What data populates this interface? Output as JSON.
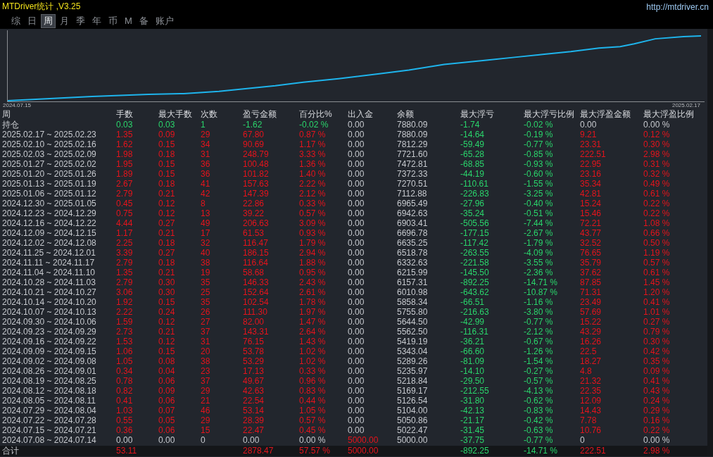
{
  "title_bar": {
    "title": "MTDriver统计 ,V3.25",
    "url": "http://mtdriver.cn"
  },
  "menu": [
    {
      "label": "综",
      "selected": false
    },
    {
      "label": "日",
      "selected": false
    },
    {
      "label": "周",
      "selected": true
    },
    {
      "label": "月",
      "selected": false
    },
    {
      "label": "季",
      "selected": false
    },
    {
      "label": "年",
      "selected": false
    },
    {
      "label": "币",
      "selected": false
    },
    {
      "label": "M",
      "selected": false
    },
    {
      "label": "备",
      "selected": false
    },
    {
      "label": "账户",
      "selected": false
    }
  ],
  "equity_chart": {
    "start_label": "2024.07.15",
    "end_label": "2025.02.17"
  },
  "table": {
    "columns": [
      "周",
      "手数",
      "最大手数",
      "次数",
      "盈亏金额",
      "百分比%",
      "出入金",
      "余额",
      "最大浮亏",
      "最大浮亏比例",
      "最大浮盈金额",
      "最大浮盈比例"
    ],
    "rows": [
      {
        "cells": [
          {
            "text": "持仓"
          },
          {
            "text": "0.03",
            "color": "#2ad46b"
          },
          {
            "text": "0.03",
            "color": "#2ad46b"
          },
          {
            "text": "1",
            "color": "#2ad46b"
          },
          {
            "text": "-1.62",
            "color": "#2ad46b"
          },
          {
            "text": "-0.02 %",
            "color": "#2ad46b"
          },
          {
            "text": "0.00",
            "color": "#c6c9ce"
          },
          {
            "text": "7880.09"
          },
          {
            "text": "-1.74",
            "color": "#2ad46b"
          },
          {
            "text": "-0.02 %",
            "color": "#2ad46b"
          },
          {
            "text": "0.00",
            "color": "#c6c9ce"
          },
          {
            "text": "0.00 %",
            "color": "#c6c9ce"
          }
        ]
      },
      {
        "cells": [
          {
            "text": "2025.02.17 ~ 2025.02.23"
          },
          {
            "text": "1.35",
            "color": "#e5141c"
          },
          {
            "text": "0.09",
            "color": "#e5141c"
          },
          {
            "text": "29",
            "color": "#e5141c"
          },
          {
            "text": "67.80",
            "color": "#e5141c"
          },
          {
            "text": "0.87 %",
            "color": "#e5141c"
          },
          {
            "text": "0.00",
            "color": "#c6c9ce"
          },
          {
            "text": "7880.09"
          },
          {
            "text": "-14.64",
            "color": "#2ad46b"
          },
          {
            "text": "-0.19 %",
            "color": "#2ad46b"
          },
          {
            "text": "9.21",
            "color": "#e5141c"
          },
          {
            "text": "0.12 %",
            "color": "#e5141c"
          }
        ]
      },
      {
        "cells": [
          {
            "text": "2025.02.10 ~ 2025.02.16"
          },
          {
            "text": "1.62",
            "color": "#e5141c"
          },
          {
            "text": "0.15",
            "color": "#e5141c"
          },
          {
            "text": "34",
            "color": "#e5141c"
          },
          {
            "text": "90.69",
            "color": "#e5141c"
          },
          {
            "text": "1.17 %",
            "color": "#e5141c"
          },
          {
            "text": "0.00",
            "color": "#c6c9ce"
          },
          {
            "text": "7812.29"
          },
          {
            "text": "-59.49",
            "color": "#2ad46b"
          },
          {
            "text": "-0.77 %",
            "color": "#2ad46b"
          },
          {
            "text": "23.31",
            "color": "#e5141c"
          },
          {
            "text": "0.30 %",
            "color": "#e5141c"
          }
        ]
      },
      {
        "cells": [
          {
            "text": "2025.02.03 ~ 2025.02.09"
          },
          {
            "text": "1.98",
            "color": "#e5141c"
          },
          {
            "text": "0.18",
            "color": "#e5141c"
          },
          {
            "text": "31",
            "color": "#e5141c"
          },
          {
            "text": "248.79",
            "color": "#e5141c"
          },
          {
            "text": "3.33 %",
            "color": "#e5141c"
          },
          {
            "text": "0.00",
            "color": "#c6c9ce"
          },
          {
            "text": "7721.60"
          },
          {
            "text": "-65.28",
            "color": "#2ad46b"
          },
          {
            "text": "-0.85 %",
            "color": "#2ad46b"
          },
          {
            "text": "222.51",
            "color": "#e5141c"
          },
          {
            "text": "2.98 %",
            "color": "#e5141c"
          }
        ]
      },
      {
        "cells": [
          {
            "text": "2025.01.27 ~ 2025.02.02"
          },
          {
            "text": "1.95",
            "color": "#e5141c"
          },
          {
            "text": "0.15",
            "color": "#e5141c"
          },
          {
            "text": "36",
            "color": "#e5141c"
          },
          {
            "text": "100.48",
            "color": "#e5141c"
          },
          {
            "text": "1.36 %",
            "color": "#e5141c"
          },
          {
            "text": "0.00",
            "color": "#c6c9ce"
          },
          {
            "text": "7472.81"
          },
          {
            "text": "-68.85",
            "color": "#2ad46b"
          },
          {
            "text": "-0.93 %",
            "color": "#2ad46b"
          },
          {
            "text": "22.95",
            "color": "#e5141c"
          },
          {
            "text": "0.31 %",
            "color": "#e5141c"
          }
        ]
      },
      {
        "cells": [
          {
            "text": "2025.01.20 ~ 2025.01.26"
          },
          {
            "text": "1.89",
            "color": "#e5141c"
          },
          {
            "text": "0.15",
            "color": "#e5141c"
          },
          {
            "text": "36",
            "color": "#e5141c"
          },
          {
            "text": "101.82",
            "color": "#e5141c"
          },
          {
            "text": "1.40 %",
            "color": "#e5141c"
          },
          {
            "text": "0.00",
            "color": "#c6c9ce"
          },
          {
            "text": "7372.33"
          },
          {
            "text": "-44.19",
            "color": "#2ad46b"
          },
          {
            "text": "-0.60 %",
            "color": "#2ad46b"
          },
          {
            "text": "23.16",
            "color": "#e5141c"
          },
          {
            "text": "0.32 %",
            "color": "#e5141c"
          }
        ]
      },
      {
        "cells": [
          {
            "text": "2025.01.13 ~ 2025.01.19"
          },
          {
            "text": "2.67",
            "color": "#e5141c"
          },
          {
            "text": "0.18",
            "color": "#e5141c"
          },
          {
            "text": "41",
            "color": "#e5141c"
          },
          {
            "text": "157.63",
            "color": "#e5141c"
          },
          {
            "text": "2.22 %",
            "color": "#e5141c"
          },
          {
            "text": "0.00",
            "color": "#c6c9ce"
          },
          {
            "text": "7270.51"
          },
          {
            "text": "-110.61",
            "color": "#2ad46b"
          },
          {
            "text": "-1.55 %",
            "color": "#2ad46b"
          },
          {
            "text": "35.34",
            "color": "#e5141c"
          },
          {
            "text": "0.49 %",
            "color": "#e5141c"
          }
        ]
      },
      {
        "cells": [
          {
            "text": "2025.01.06 ~ 2025.01.12"
          },
          {
            "text": "2.79",
            "color": "#e5141c"
          },
          {
            "text": "0.21",
            "color": "#e5141c"
          },
          {
            "text": "42",
            "color": "#e5141c"
          },
          {
            "text": "147.39",
            "color": "#e5141c"
          },
          {
            "text": "2.12 %",
            "color": "#e5141c"
          },
          {
            "text": "0.00",
            "color": "#c6c9ce"
          },
          {
            "text": "7112.88"
          },
          {
            "text": "-226.83",
            "color": "#2ad46b"
          },
          {
            "text": "-3.25 %",
            "color": "#2ad46b"
          },
          {
            "text": "42.81",
            "color": "#e5141c"
          },
          {
            "text": "0.61 %",
            "color": "#e5141c"
          }
        ]
      },
      {
        "cells": [
          {
            "text": "2024.12.30 ~ 2025.01.05"
          },
          {
            "text": "0.45",
            "color": "#e5141c"
          },
          {
            "text": "0.12",
            "color": "#e5141c"
          },
          {
            "text": "8",
            "color": "#e5141c"
          },
          {
            "text": "22.86",
            "color": "#e5141c"
          },
          {
            "text": "0.33 %",
            "color": "#e5141c"
          },
          {
            "text": "0.00",
            "color": "#c6c9ce"
          },
          {
            "text": "6965.49"
          },
          {
            "text": "-27.96",
            "color": "#2ad46b"
          },
          {
            "text": "-0.40 %",
            "color": "#2ad46b"
          },
          {
            "text": "15.24",
            "color": "#e5141c"
          },
          {
            "text": "0.22 %",
            "color": "#e5141c"
          }
        ]
      },
      {
        "cells": [
          {
            "text": "2024.12.23 ~ 2024.12.29"
          },
          {
            "text": "0.75",
            "color": "#e5141c"
          },
          {
            "text": "0.12",
            "color": "#e5141c"
          },
          {
            "text": "13",
            "color": "#e5141c"
          },
          {
            "text": "39.22",
            "color": "#e5141c"
          },
          {
            "text": "0.57 %",
            "color": "#e5141c"
          },
          {
            "text": "0.00",
            "color": "#c6c9ce"
          },
          {
            "text": "6942.63"
          },
          {
            "text": "-35.24",
            "color": "#2ad46b"
          },
          {
            "text": "-0.51 %",
            "color": "#2ad46b"
          },
          {
            "text": "15.46",
            "color": "#e5141c"
          },
          {
            "text": "0.22 %",
            "color": "#e5141c"
          }
        ]
      },
      {
        "cells": [
          {
            "text": "2024.12.16 ~ 2024.12.22"
          },
          {
            "text": "4.44",
            "color": "#e5141c"
          },
          {
            "text": "0.27",
            "color": "#e5141c"
          },
          {
            "text": "49",
            "color": "#e5141c"
          },
          {
            "text": "206.63",
            "color": "#e5141c"
          },
          {
            "text": "3.09 %",
            "color": "#e5141c"
          },
          {
            "text": "0.00",
            "color": "#c6c9ce"
          },
          {
            "text": "6903.41"
          },
          {
            "text": "-505.56",
            "color": "#2ad46b"
          },
          {
            "text": "-7.44 %",
            "color": "#2ad46b"
          },
          {
            "text": "72.21",
            "color": "#e5141c"
          },
          {
            "text": "1.08 %",
            "color": "#e5141c"
          }
        ]
      },
      {
        "cells": [
          {
            "text": "2024.12.09 ~ 2024.12.15"
          },
          {
            "text": "1.17",
            "color": "#e5141c"
          },
          {
            "text": "0.21",
            "color": "#e5141c"
          },
          {
            "text": "17",
            "color": "#e5141c"
          },
          {
            "text": "61.53",
            "color": "#e5141c"
          },
          {
            "text": "0.93 %",
            "color": "#e5141c"
          },
          {
            "text": "0.00",
            "color": "#c6c9ce"
          },
          {
            "text": "6696.78"
          },
          {
            "text": "-177.15",
            "color": "#2ad46b"
          },
          {
            "text": "-2.67 %",
            "color": "#2ad46b"
          },
          {
            "text": "43.77",
            "color": "#e5141c"
          },
          {
            "text": "0.66 %",
            "color": "#e5141c"
          }
        ]
      },
      {
        "cells": [
          {
            "text": "2024.12.02 ~ 2024.12.08"
          },
          {
            "text": "2.25",
            "color": "#e5141c"
          },
          {
            "text": "0.18",
            "color": "#e5141c"
          },
          {
            "text": "32",
            "color": "#e5141c"
          },
          {
            "text": "116.47",
            "color": "#e5141c"
          },
          {
            "text": "1.79 %",
            "color": "#e5141c"
          },
          {
            "text": "0.00",
            "color": "#c6c9ce"
          },
          {
            "text": "6635.25"
          },
          {
            "text": "-117.42",
            "color": "#2ad46b"
          },
          {
            "text": "-1.79 %",
            "color": "#2ad46b"
          },
          {
            "text": "32.52",
            "color": "#e5141c"
          },
          {
            "text": "0.50 %",
            "color": "#e5141c"
          }
        ]
      },
      {
        "cells": [
          {
            "text": "2024.11.25 ~ 2024.12.01"
          },
          {
            "text": "3.39",
            "color": "#e5141c"
          },
          {
            "text": "0.27",
            "color": "#e5141c"
          },
          {
            "text": "40",
            "color": "#e5141c"
          },
          {
            "text": "186.15",
            "color": "#e5141c"
          },
          {
            "text": "2.94 %",
            "color": "#e5141c"
          },
          {
            "text": "0.00",
            "color": "#c6c9ce"
          },
          {
            "text": "6518.78"
          },
          {
            "text": "-263.55",
            "color": "#2ad46b"
          },
          {
            "text": "-4.09 %",
            "color": "#2ad46b"
          },
          {
            "text": "76.65",
            "color": "#e5141c"
          },
          {
            "text": "1.19 %",
            "color": "#e5141c"
          }
        ]
      },
      {
        "cells": [
          {
            "text": "2024.11.11 ~ 2024.11.17"
          },
          {
            "text": "2.79",
            "color": "#e5141c"
          },
          {
            "text": "0.18",
            "color": "#e5141c"
          },
          {
            "text": "38",
            "color": "#e5141c"
          },
          {
            "text": "116.64",
            "color": "#e5141c"
          },
          {
            "text": "1.88 %",
            "color": "#e5141c"
          },
          {
            "text": "0.00",
            "color": "#c6c9ce"
          },
          {
            "text": "6332.63"
          },
          {
            "text": "-221.58",
            "color": "#2ad46b"
          },
          {
            "text": "-3.55 %",
            "color": "#2ad46b"
          },
          {
            "text": "35.79",
            "color": "#e5141c"
          },
          {
            "text": "0.57 %",
            "color": "#e5141c"
          }
        ]
      },
      {
        "cells": [
          {
            "text": "2024.11.04 ~ 2024.11.10"
          },
          {
            "text": "1.35",
            "color": "#e5141c"
          },
          {
            "text": "0.21",
            "color": "#e5141c"
          },
          {
            "text": "19",
            "color": "#e5141c"
          },
          {
            "text": "58.68",
            "color": "#e5141c"
          },
          {
            "text": "0.95 %",
            "color": "#e5141c"
          },
          {
            "text": "0.00",
            "color": "#c6c9ce"
          },
          {
            "text": "6215.99"
          },
          {
            "text": "-145.50",
            "color": "#2ad46b"
          },
          {
            "text": "-2.36 %",
            "color": "#2ad46b"
          },
          {
            "text": "37.62",
            "color": "#e5141c"
          },
          {
            "text": "0.61 %",
            "color": "#e5141c"
          }
        ]
      },
      {
        "cells": [
          {
            "text": "2024.10.28 ~ 2024.11.03"
          },
          {
            "text": "2.79",
            "color": "#e5141c"
          },
          {
            "text": "0.30",
            "color": "#e5141c"
          },
          {
            "text": "35",
            "color": "#e5141c"
          },
          {
            "text": "146.33",
            "color": "#e5141c"
          },
          {
            "text": "2.43 %",
            "color": "#e5141c"
          },
          {
            "text": "0.00",
            "color": "#c6c9ce"
          },
          {
            "text": "6157.31"
          },
          {
            "text": "-892.25",
            "color": "#2ad46b"
          },
          {
            "text": "-14.71 %",
            "color": "#2ad46b"
          },
          {
            "text": "87.85",
            "color": "#e5141c"
          },
          {
            "text": "1.45 %",
            "color": "#e5141c"
          }
        ]
      },
      {
        "cells": [
          {
            "text": "2024.10.21 ~ 2024.10.27"
          },
          {
            "text": "3.06",
            "color": "#e5141c"
          },
          {
            "text": "0.30",
            "color": "#e5141c"
          },
          {
            "text": "25",
            "color": "#e5141c"
          },
          {
            "text": "152.64",
            "color": "#e5141c"
          },
          {
            "text": "2.61 %",
            "color": "#e5141c"
          },
          {
            "text": "0.00",
            "color": "#c6c9ce"
          },
          {
            "text": "6010.98"
          },
          {
            "text": "-643.62",
            "color": "#2ad46b"
          },
          {
            "text": "-10.87 %",
            "color": "#2ad46b"
          },
          {
            "text": "71.31",
            "color": "#e5141c"
          },
          {
            "text": "1.20 %",
            "color": "#e5141c"
          }
        ]
      },
      {
        "cells": [
          {
            "text": "2024.10.14 ~ 2024.10.20"
          },
          {
            "text": "1.92",
            "color": "#e5141c"
          },
          {
            "text": "0.15",
            "color": "#e5141c"
          },
          {
            "text": "35",
            "color": "#e5141c"
          },
          {
            "text": "102.54",
            "color": "#e5141c"
          },
          {
            "text": "1.78 %",
            "color": "#e5141c"
          },
          {
            "text": "0.00",
            "color": "#c6c9ce"
          },
          {
            "text": "5858.34"
          },
          {
            "text": "-66.51",
            "color": "#2ad46b"
          },
          {
            "text": "-1.16 %",
            "color": "#2ad46b"
          },
          {
            "text": "23.49",
            "color": "#e5141c"
          },
          {
            "text": "0.41 %",
            "color": "#e5141c"
          }
        ]
      },
      {
        "cells": [
          {
            "text": "2024.10.07 ~ 2024.10.13"
          },
          {
            "text": "2.22",
            "color": "#e5141c"
          },
          {
            "text": "0.24",
            "color": "#e5141c"
          },
          {
            "text": "26",
            "color": "#e5141c"
          },
          {
            "text": "111.30",
            "color": "#e5141c"
          },
          {
            "text": "1.97 %",
            "color": "#e5141c"
          },
          {
            "text": "0.00",
            "color": "#c6c9ce"
          },
          {
            "text": "5755.80"
          },
          {
            "text": "-216.63",
            "color": "#2ad46b"
          },
          {
            "text": "-3.80 %",
            "color": "#2ad46b"
          },
          {
            "text": "57.69",
            "color": "#e5141c"
          },
          {
            "text": "1.01 %",
            "color": "#e5141c"
          }
        ]
      },
      {
        "cells": [
          {
            "text": "2024.09.30 ~ 2024.10.06"
          },
          {
            "text": "1.59",
            "color": "#e5141c"
          },
          {
            "text": "0.12",
            "color": "#e5141c"
          },
          {
            "text": "27",
            "color": "#e5141c"
          },
          {
            "text": "82.00",
            "color": "#e5141c"
          },
          {
            "text": "1.47 %",
            "color": "#e5141c"
          },
          {
            "text": "0.00",
            "color": "#c6c9ce"
          },
          {
            "text": "5644.50"
          },
          {
            "text": "-42.99",
            "color": "#2ad46b"
          },
          {
            "text": "-0.77 %",
            "color": "#2ad46b"
          },
          {
            "text": "15.22",
            "color": "#e5141c"
          },
          {
            "text": "0.27 %",
            "color": "#e5141c"
          }
        ]
      },
      {
        "cells": [
          {
            "text": "2024.09.23 ~ 2024.09.29"
          },
          {
            "text": "2.73",
            "color": "#e5141c"
          },
          {
            "text": "0.21",
            "color": "#e5141c"
          },
          {
            "text": "37",
            "color": "#e5141c"
          },
          {
            "text": "143.31",
            "color": "#e5141c"
          },
          {
            "text": "2.64 %",
            "color": "#e5141c"
          },
          {
            "text": "0.00",
            "color": "#c6c9ce"
          },
          {
            "text": "5562.50"
          },
          {
            "text": "-116.31",
            "color": "#2ad46b"
          },
          {
            "text": "-2.12 %",
            "color": "#2ad46b"
          },
          {
            "text": "43.29",
            "color": "#e5141c"
          },
          {
            "text": "0.79 %",
            "color": "#e5141c"
          }
        ]
      },
      {
        "cells": [
          {
            "text": "2024.09.16 ~ 2024.09.22"
          },
          {
            "text": "1.53",
            "color": "#e5141c"
          },
          {
            "text": "0.12",
            "color": "#e5141c"
          },
          {
            "text": "31",
            "color": "#e5141c"
          },
          {
            "text": "76.15",
            "color": "#e5141c"
          },
          {
            "text": "1.43 %",
            "color": "#e5141c"
          },
          {
            "text": "0.00",
            "color": "#c6c9ce"
          },
          {
            "text": "5419.19"
          },
          {
            "text": "-36.21",
            "color": "#2ad46b"
          },
          {
            "text": "-0.67 %",
            "color": "#2ad46b"
          },
          {
            "text": "16.26",
            "color": "#e5141c"
          },
          {
            "text": "0.30 %",
            "color": "#e5141c"
          }
        ]
      },
      {
        "cells": [
          {
            "text": "2024.09.09 ~ 2024.09.15"
          },
          {
            "text": "1.06",
            "color": "#e5141c"
          },
          {
            "text": "0.15",
            "color": "#e5141c"
          },
          {
            "text": "20",
            "color": "#e5141c"
          },
          {
            "text": "53.78",
            "color": "#e5141c"
          },
          {
            "text": "1.02 %",
            "color": "#e5141c"
          },
          {
            "text": "0.00",
            "color": "#c6c9ce"
          },
          {
            "text": "5343.04"
          },
          {
            "text": "-66.60",
            "color": "#2ad46b"
          },
          {
            "text": "-1.26 %",
            "color": "#2ad46b"
          },
          {
            "text": "22.5",
            "color": "#e5141c"
          },
          {
            "text": "0.42 %",
            "color": "#e5141c"
          }
        ]
      },
      {
        "cells": [
          {
            "text": "2024.09.02 ~ 2024.09.08"
          },
          {
            "text": "1.05",
            "color": "#e5141c"
          },
          {
            "text": "0.08",
            "color": "#e5141c"
          },
          {
            "text": "38",
            "color": "#e5141c"
          },
          {
            "text": "53.29",
            "color": "#e5141c"
          },
          {
            "text": "1.02 %",
            "color": "#e5141c"
          },
          {
            "text": "0.00",
            "color": "#c6c9ce"
          },
          {
            "text": "5289.26"
          },
          {
            "text": "-81.09",
            "color": "#2ad46b"
          },
          {
            "text": "-1.54 %",
            "color": "#2ad46b"
          },
          {
            "text": "18.27",
            "color": "#e5141c"
          },
          {
            "text": "0.35 %",
            "color": "#e5141c"
          }
        ]
      },
      {
        "cells": [
          {
            "text": "2024.08.26 ~ 2024.09.01"
          },
          {
            "text": "0.34",
            "color": "#e5141c"
          },
          {
            "text": "0.04",
            "color": "#e5141c"
          },
          {
            "text": "23",
            "color": "#e5141c"
          },
          {
            "text": "17.13",
            "color": "#e5141c"
          },
          {
            "text": "0.33 %",
            "color": "#e5141c"
          },
          {
            "text": "0.00",
            "color": "#c6c9ce"
          },
          {
            "text": "5235.97"
          },
          {
            "text": "-14.10",
            "color": "#2ad46b"
          },
          {
            "text": "-0.27 %",
            "color": "#2ad46b"
          },
          {
            "text": "4.8",
            "color": "#e5141c"
          },
          {
            "text": "0.09 %",
            "color": "#e5141c"
          }
        ]
      },
      {
        "cells": [
          {
            "text": "2024.08.19 ~ 2024.08.25"
          },
          {
            "text": "0.78",
            "color": "#e5141c"
          },
          {
            "text": "0.06",
            "color": "#e5141c"
          },
          {
            "text": "37",
            "color": "#e5141c"
          },
          {
            "text": "49.67",
            "color": "#e5141c"
          },
          {
            "text": "0.96 %",
            "color": "#e5141c"
          },
          {
            "text": "0.00",
            "color": "#c6c9ce"
          },
          {
            "text": "5218.84"
          },
          {
            "text": "-29.50",
            "color": "#2ad46b"
          },
          {
            "text": "-0.57 %",
            "color": "#2ad46b"
          },
          {
            "text": "21.32",
            "color": "#e5141c"
          },
          {
            "text": "0.41 %",
            "color": "#e5141c"
          }
        ]
      },
      {
        "cells": [
          {
            "text": "2024.08.12 ~ 2024.08.18"
          },
          {
            "text": "0.82",
            "color": "#e5141c"
          },
          {
            "text": "0.09",
            "color": "#e5141c"
          },
          {
            "text": "29",
            "color": "#e5141c"
          },
          {
            "text": "42.63",
            "color": "#e5141c"
          },
          {
            "text": "0.83 %",
            "color": "#e5141c"
          },
          {
            "text": "0.00",
            "color": "#c6c9ce"
          },
          {
            "text": "5169.17"
          },
          {
            "text": "-212.55",
            "color": "#2ad46b"
          },
          {
            "text": "-4.13 %",
            "color": "#2ad46b"
          },
          {
            "text": "22.35",
            "color": "#e5141c"
          },
          {
            "text": "0.43 %",
            "color": "#e5141c"
          }
        ]
      },
      {
        "cells": [
          {
            "text": "2024.08.05 ~ 2024.08.11"
          },
          {
            "text": "0.41",
            "color": "#e5141c"
          },
          {
            "text": "0.06",
            "color": "#e5141c"
          },
          {
            "text": "21",
            "color": "#e5141c"
          },
          {
            "text": "22.54",
            "color": "#e5141c"
          },
          {
            "text": "0.44 %",
            "color": "#e5141c"
          },
          {
            "text": "0.00",
            "color": "#c6c9ce"
          },
          {
            "text": "5126.54"
          },
          {
            "text": "-31.80",
            "color": "#2ad46b"
          },
          {
            "text": "-0.62 %",
            "color": "#2ad46b"
          },
          {
            "text": "12.09",
            "color": "#e5141c"
          },
          {
            "text": "0.24 %",
            "color": "#e5141c"
          }
        ]
      },
      {
        "cells": [
          {
            "text": "2024.07.29 ~ 2024.08.04"
          },
          {
            "text": "1.03",
            "color": "#e5141c"
          },
          {
            "text": "0.07",
            "color": "#e5141c"
          },
          {
            "text": "46",
            "color": "#e5141c"
          },
          {
            "text": "53.14",
            "color": "#e5141c"
          },
          {
            "text": "1.05 %",
            "color": "#e5141c"
          },
          {
            "text": "0.00",
            "color": "#c6c9ce"
          },
          {
            "text": "5104.00"
          },
          {
            "text": "-42.13",
            "color": "#2ad46b"
          },
          {
            "text": "-0.83 %",
            "color": "#2ad46b"
          },
          {
            "text": "14.43",
            "color": "#e5141c"
          },
          {
            "text": "0.29 %",
            "color": "#e5141c"
          }
        ]
      },
      {
        "cells": [
          {
            "text": "2024.07.22 ~ 2024.07.28"
          },
          {
            "text": "0.55",
            "color": "#e5141c"
          },
          {
            "text": "0.05",
            "color": "#e5141c"
          },
          {
            "text": "29",
            "color": "#e5141c"
          },
          {
            "text": "28.39",
            "color": "#e5141c"
          },
          {
            "text": "0.57 %",
            "color": "#e5141c"
          },
          {
            "text": "0.00",
            "color": "#c6c9ce"
          },
          {
            "text": "5050.86"
          },
          {
            "text": "-21.17",
            "color": "#2ad46b"
          },
          {
            "text": "-0.42 %",
            "color": "#2ad46b"
          },
          {
            "text": "7.78",
            "color": "#e5141c"
          },
          {
            "text": "0.16 %",
            "color": "#e5141c"
          }
        ]
      },
      {
        "cells": [
          {
            "text": "2024.07.15 ~ 2024.07.21"
          },
          {
            "text": "0.36",
            "color": "#e5141c"
          },
          {
            "text": "0.06",
            "color": "#e5141c"
          },
          {
            "text": "15",
            "color": "#e5141c"
          },
          {
            "text": "22.47",
            "color": "#e5141c"
          },
          {
            "text": "0.45 %",
            "color": "#e5141c"
          },
          {
            "text": "0.00",
            "color": "#c6c9ce"
          },
          {
            "text": "5022.47"
          },
          {
            "text": "-31.45",
            "color": "#2ad46b"
          },
          {
            "text": "-0.63 %",
            "color": "#2ad46b"
          },
          {
            "text": "10.76",
            "color": "#e5141c"
          },
          {
            "text": "0.22 %",
            "color": "#e5141c"
          }
        ]
      },
      {
        "cells": [
          {
            "text": "2024.07.08 ~ 2024.07.14"
          },
          {
            "text": "0.00",
            "color": "#c6c9ce"
          },
          {
            "text": "0.00",
            "color": "#c6c9ce"
          },
          {
            "text": "0",
            "color": "#c6c9ce"
          },
          {
            "text": "0.00",
            "color": "#c6c9ce"
          },
          {
            "text": "0.00 %",
            "color": "#c6c9ce"
          },
          {
            "text": "5000.00",
            "color": "#e5141c"
          },
          {
            "text": "5000.00"
          },
          {
            "text": "-37.75",
            "color": "#2ad46b"
          },
          {
            "text": "-0.77 %",
            "color": "#2ad46b"
          },
          {
            "text": "0",
            "color": "#c6c9ce"
          },
          {
            "text": "0.00 %",
            "color": "#c6c9ce"
          }
        ]
      }
    ],
    "totals": {
      "label": {
        "text": "合计"
      },
      "lots": {
        "text": "53.11",
        "color": "#e5141c"
      },
      "profit": {
        "text": "2878.47",
        "color": "#e5141c"
      },
      "percent": {
        "text": "57.57 %",
        "color": "#e5141c"
      },
      "deposit": {
        "text": "5000.00",
        "color": "#e5141c"
      },
      "max_float_loss": {
        "text": "-892.25",
        "color": "#2ad46b"
      },
      "max_float_loss_pct": {
        "text": "-14.71 %",
        "color": "#2ad46b"
      },
      "max_float_profit": {
        "text": "222.51",
        "color": "#e5141c"
      },
      "max_float_profit_pct": {
        "text": "2.98 %",
        "color": "#e5141c"
      }
    }
  }
}
